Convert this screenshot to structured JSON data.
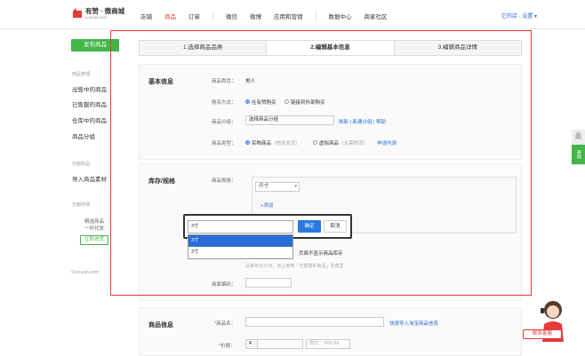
{
  "header": {
    "logo_text": "有赞 · 微商城",
    "logo_sub": "youzan.com",
    "nav": [
      "店铺",
      "商品",
      "订单",
      "微信",
      "微博",
      "应用和营销",
      "数据中心",
      "商家社区"
    ],
    "active_nav_index": 1,
    "user_text": "它的店 · 设置 ▾"
  },
  "sidebar": {
    "publish_button": "发布商品",
    "group1_title": "商品管理",
    "group1_items": [
      "出售中的商品",
      "已售罄的商品",
      "仓库中的商品",
      "商品分组"
    ],
    "group2_title": "外部商品",
    "group2_items": [
      "导入商品素材"
    ],
    "group3_title": "分销市场",
    "promo_line1": "精选商品",
    "promo_line2": "一件代发",
    "promo_button": "立即进货",
    "footer": "©youzan.com"
  },
  "steps": [
    "1.选择商品品类",
    "2.编辑基本信息",
    "3.编辑商品详情"
  ],
  "active_step_index": 1,
  "basic": {
    "title": "基本信息",
    "category_label": "商品类目：",
    "category_value": "男人",
    "buy_label": "购买方式：",
    "buy_opt1": "在有赞购买",
    "buy_opt2": "链接到外部购买",
    "group_label": "商品分组：",
    "group_placeholder": "选择商品分组",
    "group_links": "刷新 | 新建分组 | 帮助",
    "type_label": "商品类型：",
    "type_opt1": "实物商品",
    "type_opt1_note": "（物流发货）",
    "type_opt2": "虚拟商品",
    "type_opt2_note": "（无需物流）",
    "type_link": "申请内测"
  },
  "stock": {
    "title": "库存/规格",
    "spec_label": "商品规格：",
    "spec_select": "尺寸",
    "add_link": "+添加",
    "stock_note": "页面不显示商品库存",
    "stock_tip": "总库存为 0 时，会上架到「已售罄的商品」列表里",
    "code_label": "商家编码："
  },
  "popup": {
    "input_value": "3寸",
    "ok": "确定",
    "cancel": "取消",
    "options": [
      "3寸",
      "3寸"
    ],
    "selected_index": 0
  },
  "product": {
    "title": "商品信息",
    "name_label": "*商品名：",
    "name_link": "快速导入淘宝商品信息",
    "price_label": "*价格：",
    "price_prefix": "¥",
    "orig_price_placeholder": "原价：¥99.99"
  },
  "float": {
    "help": "帮助",
    "service": "联系客服"
  }
}
